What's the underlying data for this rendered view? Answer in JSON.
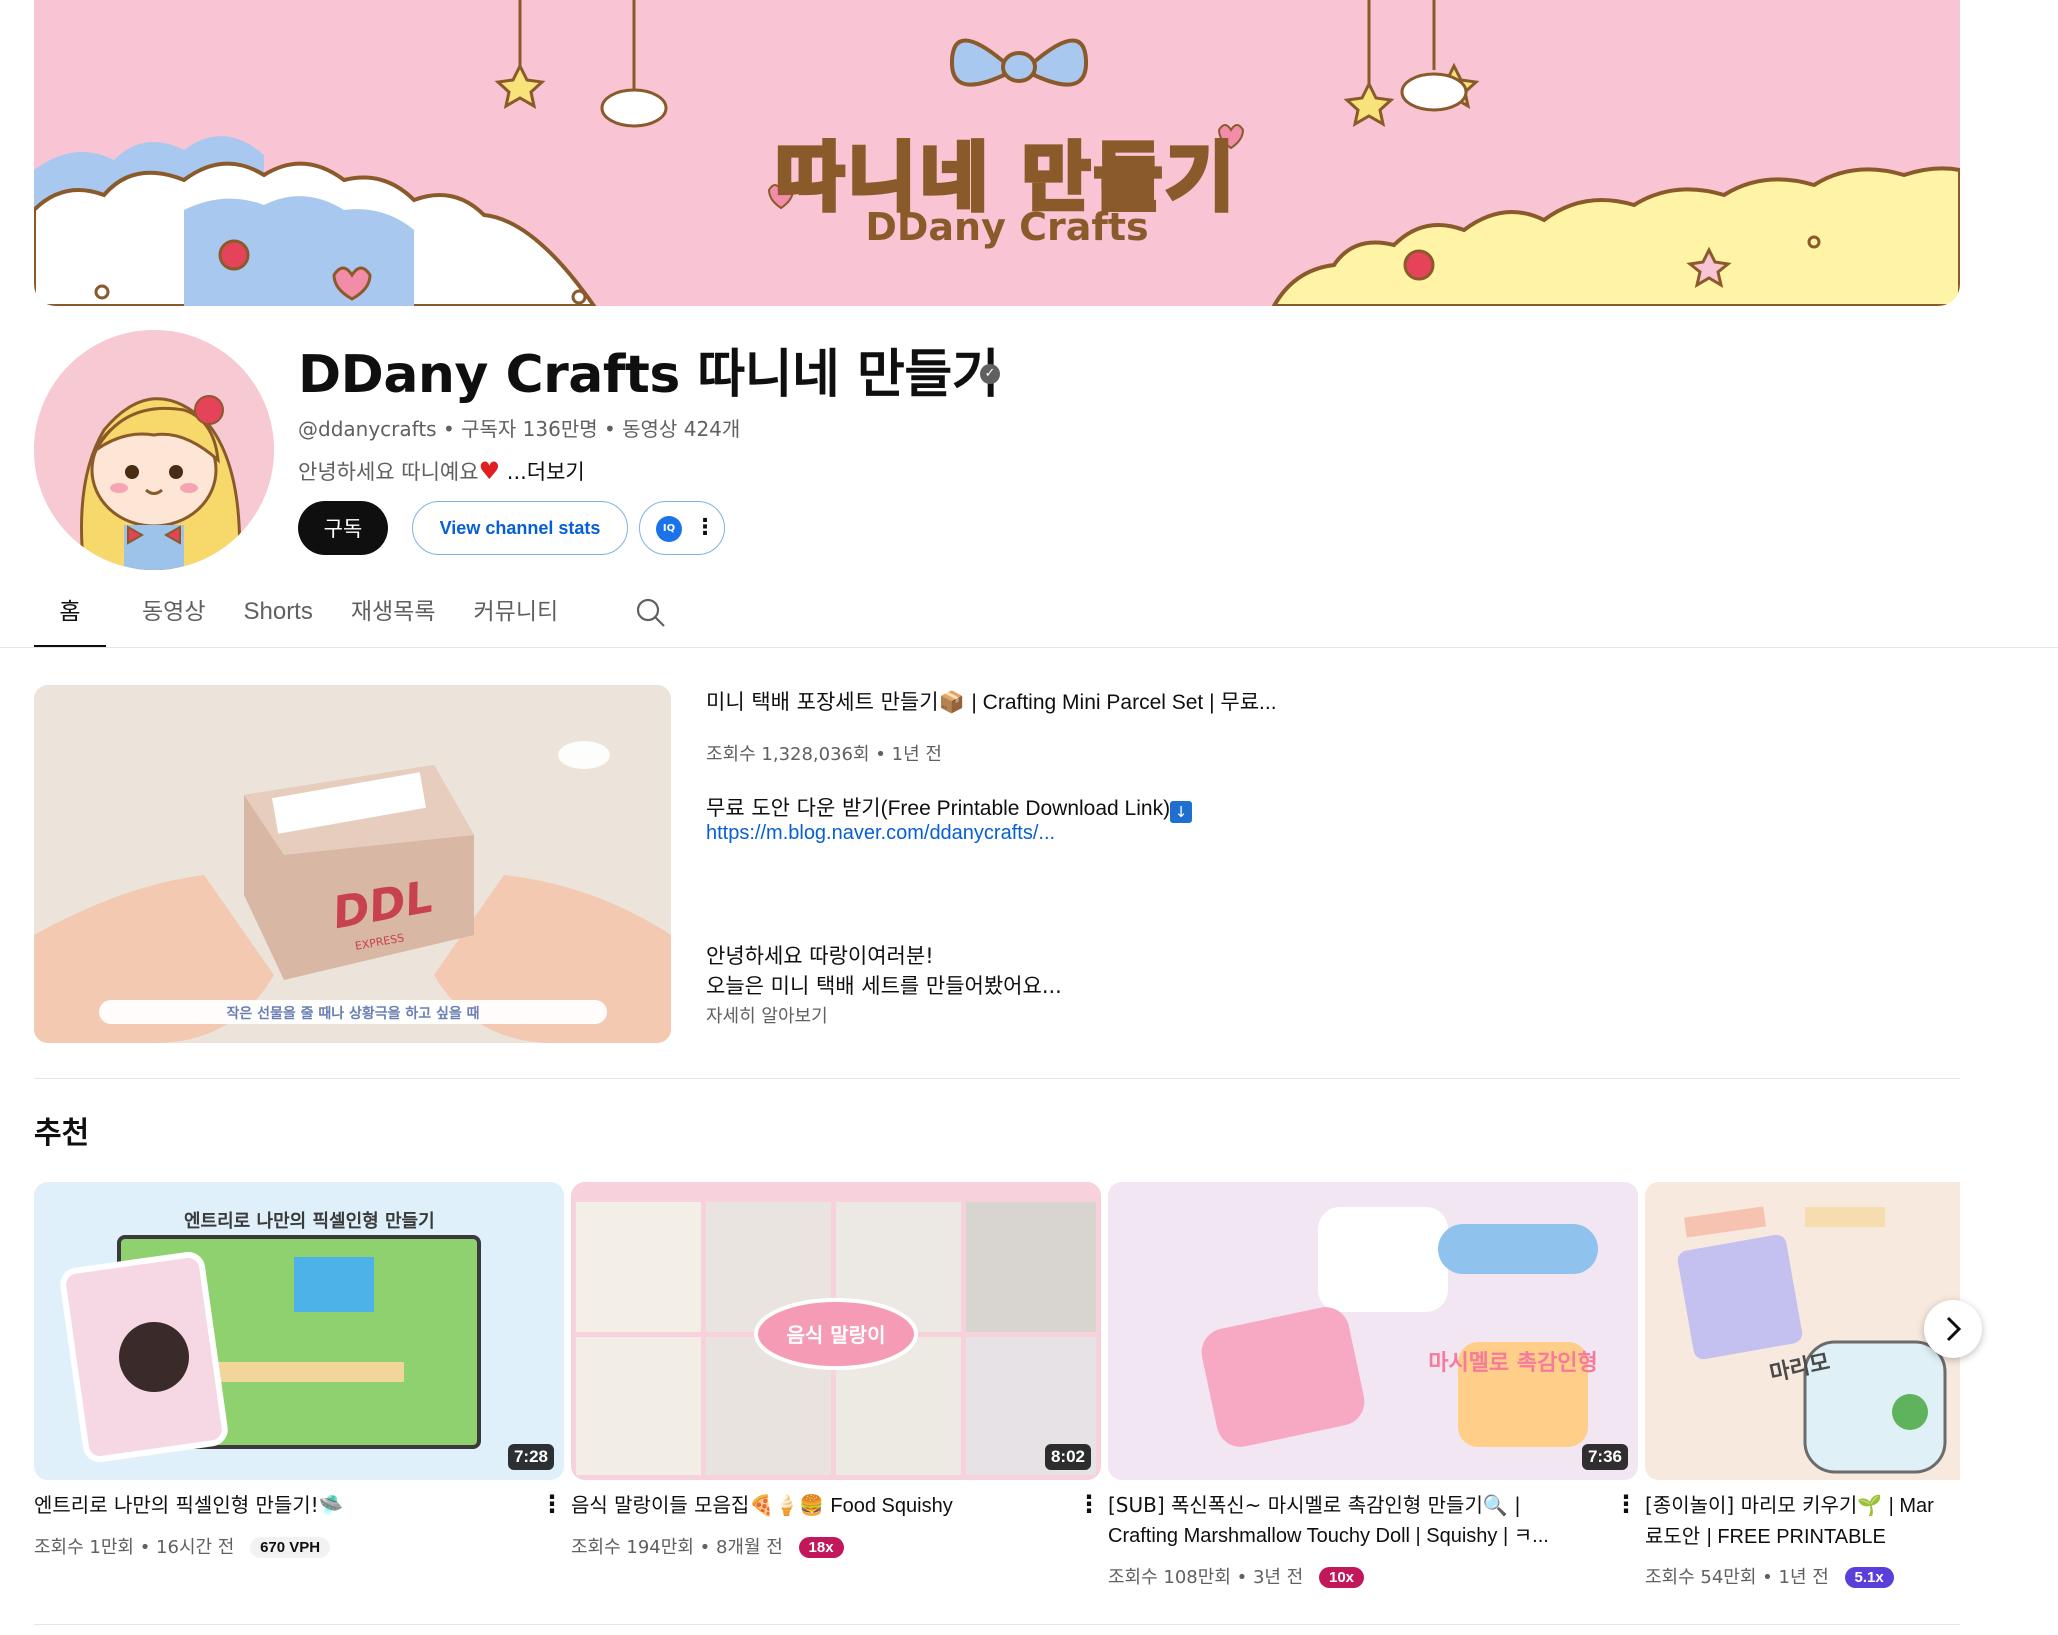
{
  "banner": {
    "title_ko": "따니네 만들기",
    "title_en": "DDany Crafts"
  },
  "channel": {
    "name": "DDany Crafts 따니네 만들기",
    "handle": "@ddanycrafts",
    "subscribers": "구독자 136만명",
    "videos": "동영상 424개",
    "description": "안녕하세요 따니예요",
    "more": "...더보기"
  },
  "buttons": {
    "subscribe": "구독",
    "stats": "View channel stats",
    "ext_icon": "IQ"
  },
  "tabs": [
    "홈",
    "동영상",
    "Shorts",
    "재생목록",
    "커뮤니티"
  ],
  "featured": {
    "title_ko": "미니 택배 포장세트 만들기",
    "title_en": "| Crafting Mini Parcel Set | 무료...",
    "meta": "조회수 1,328,036회 • 1년 전",
    "line1_ko": "무료 도안 다운 받기",
    "line1_en": "(Free Printable Download Link)",
    "link": "https://m.blog.naver.com/ddanycrafts/...",
    "line2": "안녕하세요 따랑이여러분!",
    "line3": "오늘은 미니 택배 세트를 만들어봤어요...",
    "readmore": "자세히 알아보기",
    "caption": "작은 선물을 줄 때나 상황극을 하고 싶을 때",
    "box_text": "DDL",
    "box_sub": "EXPRESS"
  },
  "section_title": "추천",
  "videos": [
    {
      "title": "엔트리로 나만의 픽셀인형 만들기!",
      "duration": "7:28",
      "views": "조회수 1만회",
      "age": "16시간 전",
      "badge": "670 VPH",
      "badge_bg": "#f2f2f2",
      "badge_fg": "#0f0f0f",
      "thumb_text": "엔트리로 나만의 픽셀인형 만들기"
    },
    {
      "title": "음식 말랑이들 모음집",
      "title_en": "Food Squishy",
      "duration": "8:02",
      "views": "조회수 194만회",
      "age": "8개월 전",
      "badge": "18x",
      "badge_bg": "#c2185b",
      "badge_fg": "#ffffff",
      "thumb_text": "음식 말랑이"
    },
    {
      "title": "[SUB] 폭신폭신~ 마시멜로 촉감인형 만들기",
      "title_line2": "Crafting Marshmallow Touchy Doll | Squishy | ㅋ...",
      "duration": "7:36",
      "views": "조회수 108만회",
      "age": "3년 전",
      "badge": "10x",
      "badge_bg": "#c2185b",
      "badge_fg": "#ffffff",
      "thumb_text": "마시멜로 촉감인형"
    },
    {
      "title": "[종이놀이] 마리모 키우기",
      "title_en": "| Mar",
      "title_line2_ko": "료도안",
      "title_line2_en": "| FREE PRINTABLE",
      "views": "조회수 54만회",
      "age": "1년 전",
      "badge": "5.1x",
      "badge_bg": "#5b3fd9",
      "badge_fg": "#ffffff",
      "thumb_text": "마리모"
    }
  ],
  "colors": {
    "banner_pink": "#f9c4d3",
    "link_blue": "#065fd4",
    "subscribe_black": "#0f0f0f"
  }
}
